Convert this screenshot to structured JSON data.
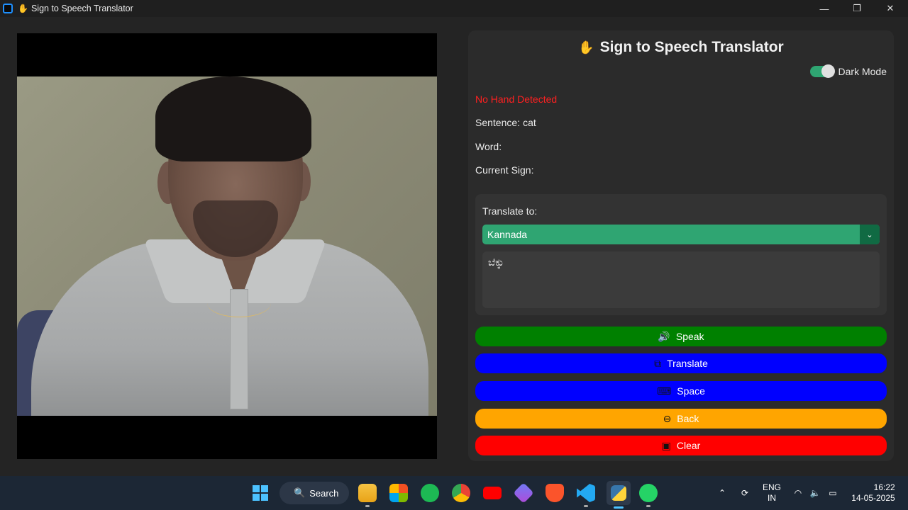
{
  "window": {
    "title": "Sign to Speech Translator",
    "controls": {
      "minimize": "—",
      "maximize": "❐",
      "close": "✕"
    }
  },
  "panel": {
    "heading": "Sign to Speech Translator",
    "dark_mode_label": "Dark Mode",
    "dark_mode_on": true,
    "status": "No Hand Detected",
    "sentence_label": "Sentence:",
    "sentence_value": "cat",
    "word_label": "Word:",
    "word_value": "",
    "current_sign_label": "Current Sign:",
    "current_sign_value": "",
    "translate_to_label": "Translate to:",
    "language_selected": "Kannada",
    "translated_text": "ಬೆಕ್ಕು",
    "buttons": {
      "speak": "Speak",
      "translate": "Translate",
      "space": "Space",
      "back": "Back",
      "clear": "Clear"
    },
    "colors": {
      "speak": "#008000",
      "translate": "#0000ff",
      "space": "#0000ff",
      "back": "#ffa500",
      "clear": "#ff0000",
      "accent": "#2fa572",
      "status": "#ff2020"
    }
  },
  "taskbar": {
    "search_label": "Search",
    "apps": [
      "start-icon",
      "search-icon",
      "file-explorer-icon",
      "microsoft-store-icon",
      "spotify-icon",
      "chrome-icon",
      "youtube-icon",
      "media-player-icon",
      "brave-icon",
      "vscode-icon",
      "python-icon",
      "whatsapp-icon"
    ],
    "language_line1": "ENG",
    "language_line2": "IN",
    "time": "16:22",
    "date": "14-05-2025"
  }
}
